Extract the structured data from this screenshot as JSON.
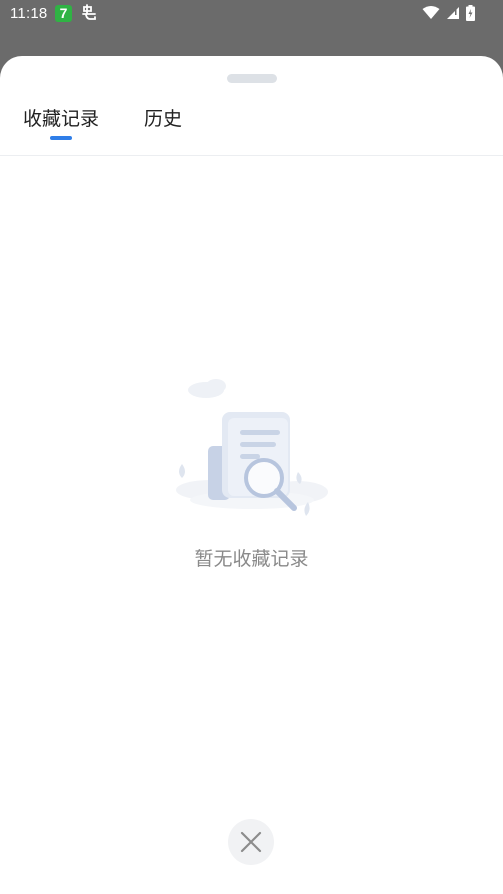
{
  "status_bar": {
    "time": "11:18",
    "badge_text": "7",
    "icons": [
      "app-notification-icon",
      "wifi-icon",
      "signal-icon",
      "battery-icon"
    ]
  },
  "tabs": [
    {
      "label": "收藏记录",
      "active": true
    },
    {
      "label": "历史",
      "active": false
    }
  ],
  "empty_state": {
    "message": "暂无收藏记录",
    "icon": "empty-document-search-icon"
  },
  "close_button": {
    "icon": "close-icon"
  },
  "colors": {
    "accent": "#2f7ee8",
    "scrim": "#6b6b6b",
    "empty_text": "#8a8a8a",
    "badge": "#2fb344"
  }
}
